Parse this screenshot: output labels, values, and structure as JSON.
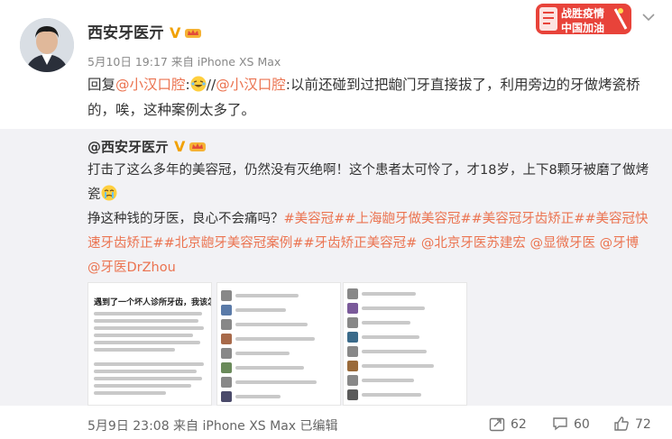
{
  "post": {
    "author": "西安牙医亓",
    "badge_v": "V",
    "meta": "5月10日 19:17 来自 iPhone XS Max",
    "reply_prefix": "回复",
    "mention1": "@小汉口腔",
    "sep": ":",
    "slashes": "//",
    "mention2": "@小汉口腔",
    "reply_rest": ":以前还碰到过把龅门牙直接拔了，利用旁边的牙做烤瓷桥的，唉，这种案例太多了。"
  },
  "promo": {
    "line1": "战胜疫情",
    "line2": "中国加油"
  },
  "quote": {
    "author": "@西安牙医亓",
    "badge_v": "V",
    "text1": "打击了这么多年的美容冠，仍然没有灭绝啊！这个患者太可怜了，才18岁，上下8颗牙被磨了做烤瓷",
    "text2": "挣这种钱的牙医，良心不会痛吗？",
    "tags": "#美容冠##上海龅牙做美容冠##美容冠牙齿矫正##美容冠快速牙齿矫正##北京龅牙美容冠案例##牙齿矫正美容冠#",
    "mentions": " @北京牙医苏建宏 @显微牙医 @牙博 @牙医DrZhou",
    "thumb1_title": "遇到了一个坏人诊所牙齿，我该怎么办?"
  },
  "footer": {
    "meta": "5月9日 23:08 来自 iPhone XS Max  已编辑",
    "repost_count": "62",
    "comment_count": "60",
    "like_count": "72"
  },
  "icons": [
    "v-badge-icon",
    "crown-icon",
    "laugh-cry-emoji-icon",
    "cry-emoji-icon",
    "repost-icon",
    "comment-icon",
    "like-icon",
    "chevron-down-icon"
  ],
  "colors": {
    "link": "#eb7350",
    "badge": "#f1a100",
    "quote_bg": "#f2f2f5",
    "text": "#333333",
    "meta": "#888888"
  }
}
